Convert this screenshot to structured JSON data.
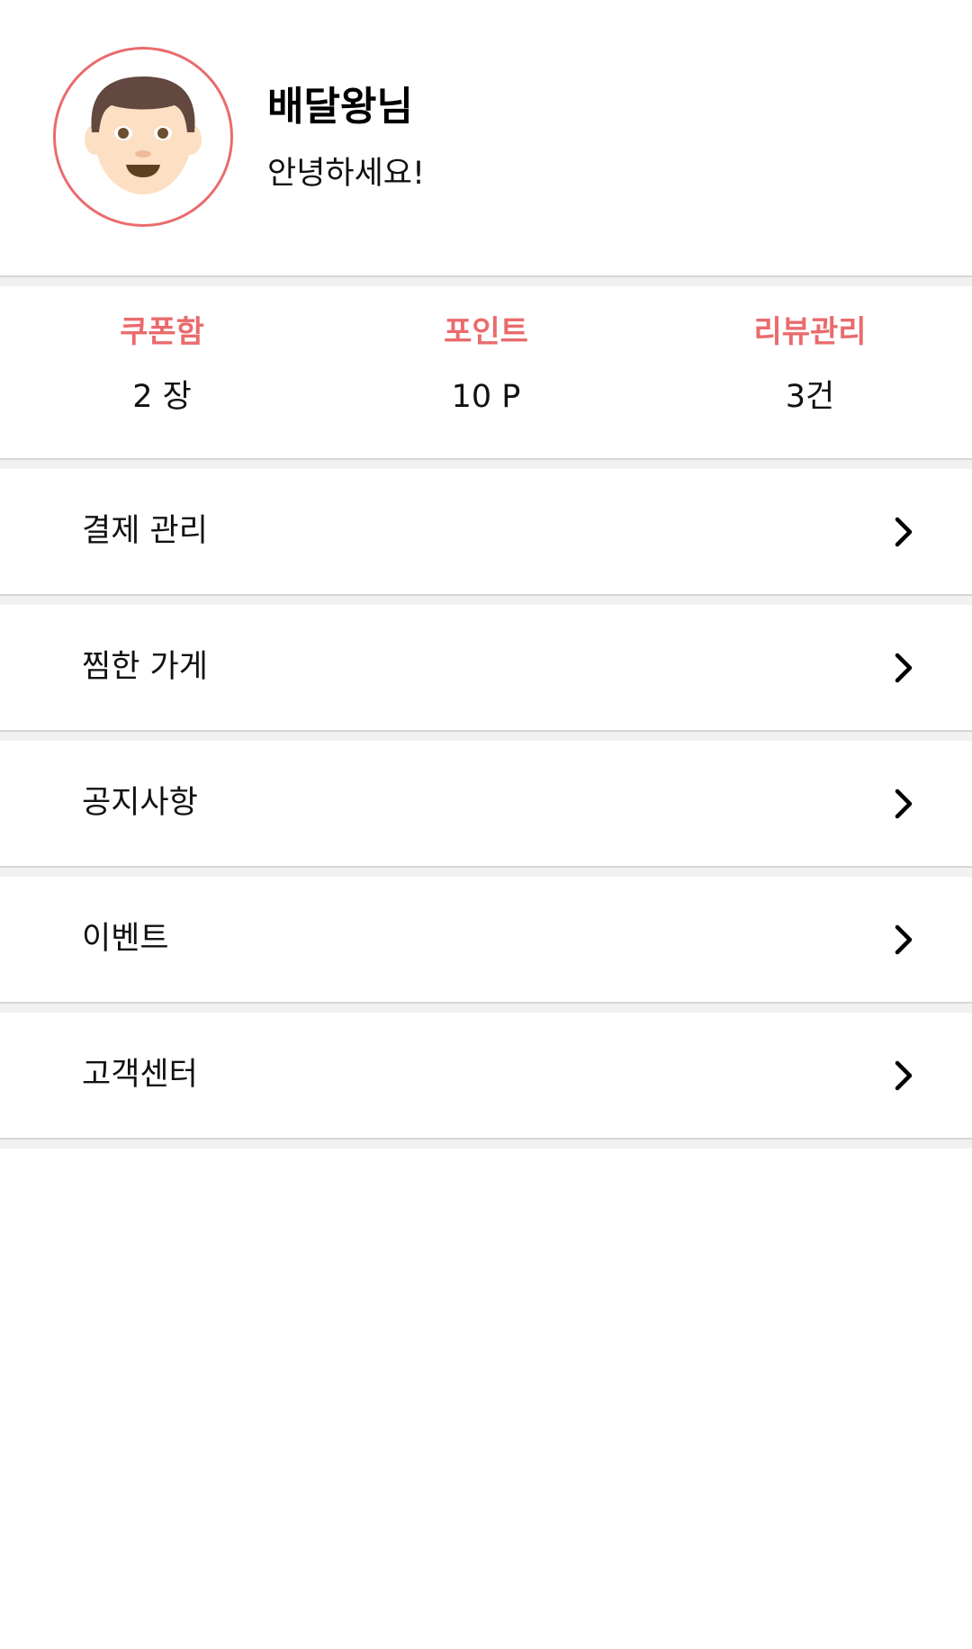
{
  "profile": {
    "avatar_icon": "man-face-emoji-icon",
    "name": "배달왕님",
    "greeting": "안녕하세요!"
  },
  "stats": [
    {
      "label": "쿠폰함",
      "value": "2 장"
    },
    {
      "label": "포인트",
      "value": "10 P"
    },
    {
      "label": "리뷰관리",
      "value": "3건"
    }
  ],
  "menu": [
    {
      "label": "결제 관리",
      "icon": "chevron-right-icon"
    },
    {
      "label": "찜한 가게",
      "icon": "chevron-right-icon"
    },
    {
      "label": "공지사항",
      "icon": "chevron-right-icon"
    },
    {
      "label": "이벤트",
      "icon": "chevron-right-icon"
    },
    {
      "label": "고객센터",
      "icon": "chevron-right-icon"
    }
  ],
  "colors": {
    "accent": "#ea6b6d",
    "divider": "#f1f1f1",
    "divider_line": "#d6d6d6",
    "text": "#111111"
  }
}
